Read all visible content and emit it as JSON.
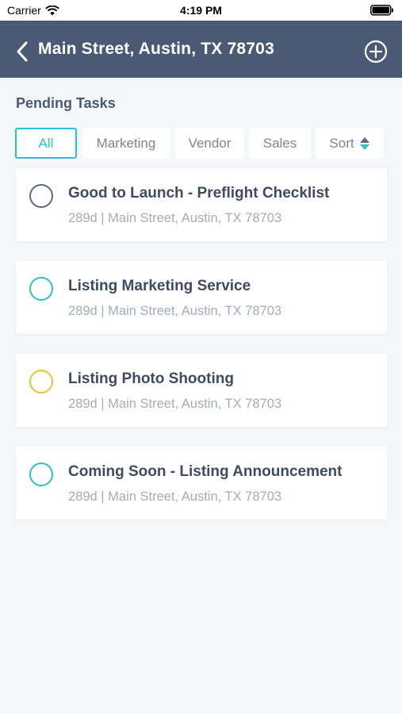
{
  "status_bar": {
    "carrier": "Carrier",
    "time": "4:19 PM"
  },
  "nav": {
    "title": "Main Street, Austin, TX 78703"
  },
  "section": {
    "title": "Pending Tasks"
  },
  "tabs": [
    {
      "label": "All",
      "active": true
    },
    {
      "label": "Marketing",
      "active": false
    },
    {
      "label": "Vendor",
      "active": false
    },
    {
      "label": "Sales",
      "active": false
    },
    {
      "label": "Sort",
      "active": false
    }
  ],
  "tasks": [
    {
      "title": "Good to Launch - Preflight Checklist",
      "subtitle": "289d | Main Street, Austin, TX 78703",
      "circle_color": "#5a6a80"
    },
    {
      "title": "Listing Marketing Service",
      "subtitle": "289d | Main Street, Austin, TX 78703",
      "circle_color": "#2fbfcb"
    },
    {
      "title": "Listing Photo Shooting",
      "subtitle": "289d | Main Street, Austin, TX 78703",
      "circle_color": "#f0c02e"
    },
    {
      "title": "Coming Soon - Listing Announcement",
      "subtitle": "289d | Main Street, Austin, TX 78703",
      "circle_color": "#2fbfcb"
    }
  ],
  "colors": {
    "header_bg": "#4a5a74",
    "accent": "#27c3cf"
  }
}
